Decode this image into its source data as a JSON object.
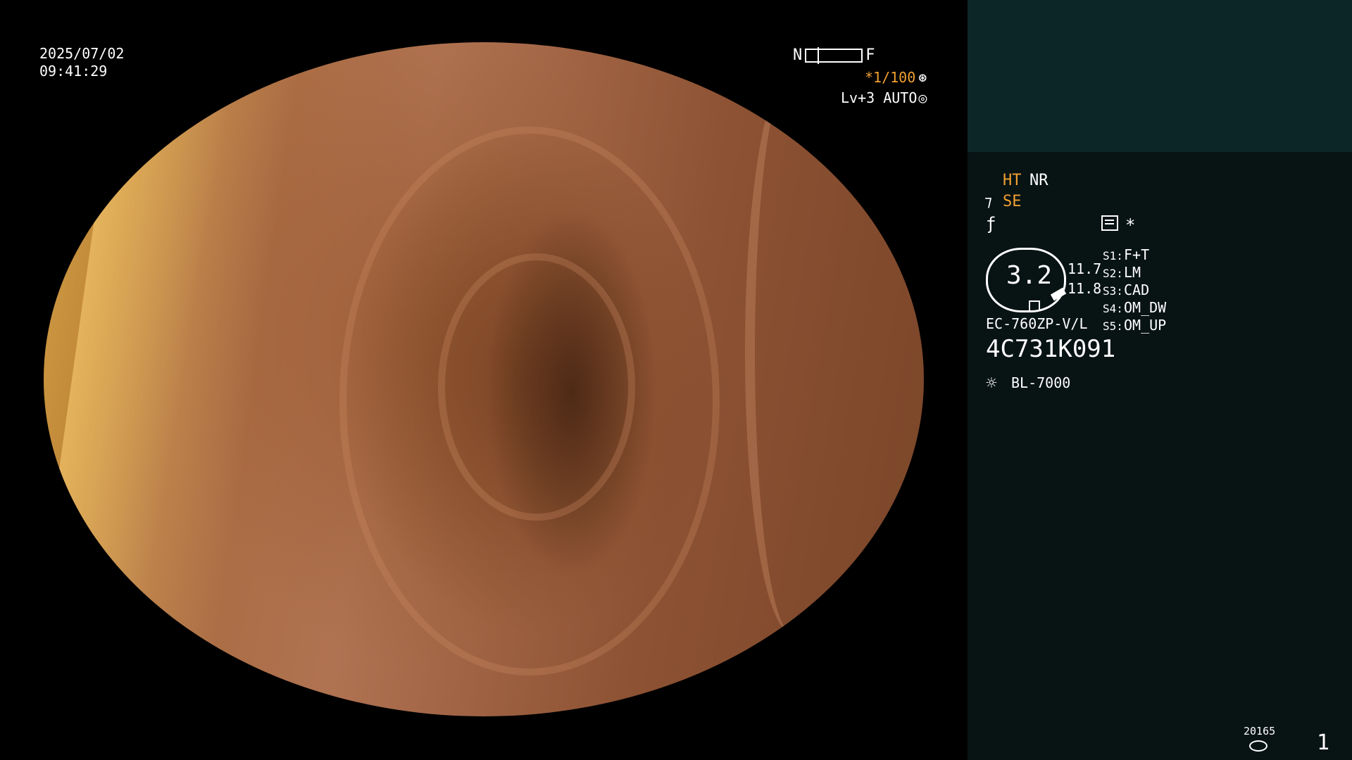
{
  "overlay": {
    "date": "2025/07/02",
    "time": "09:41:29",
    "focus_near": "N",
    "focus_far": "F",
    "shutter": "*1/100",
    "shutter_icon": "⊛",
    "level": "Lv+3 AUTO",
    "level_icon": "◎"
  },
  "panel": {
    "ht": "HT",
    "nr": "NR",
    "se_icon": "⁊",
    "se": "SE",
    "f_icon": "ƒ",
    "star": "*",
    "scope_value": "3.2",
    "value_1": "11.7",
    "value_2": "11.8",
    "switches": [
      {
        "label": "S1:",
        "value": "F+T"
      },
      {
        "label": "S2:",
        "value": "LM"
      },
      {
        "label": "S3:",
        "value": "CAD"
      },
      {
        "label": "S4:",
        "value": "OM_DW"
      },
      {
        "label": "S5:",
        "value": "OM_UP"
      }
    ],
    "model": "EC-760ZP-V/L",
    "serial": "4C731K091",
    "light_icon": "☼",
    "light_source": "BL-7000",
    "counter": "20165",
    "page_number": "1"
  },
  "colors": {
    "accent": "#f0a030",
    "panel_bg": "#081314",
    "panel_top": "#0c2628"
  }
}
